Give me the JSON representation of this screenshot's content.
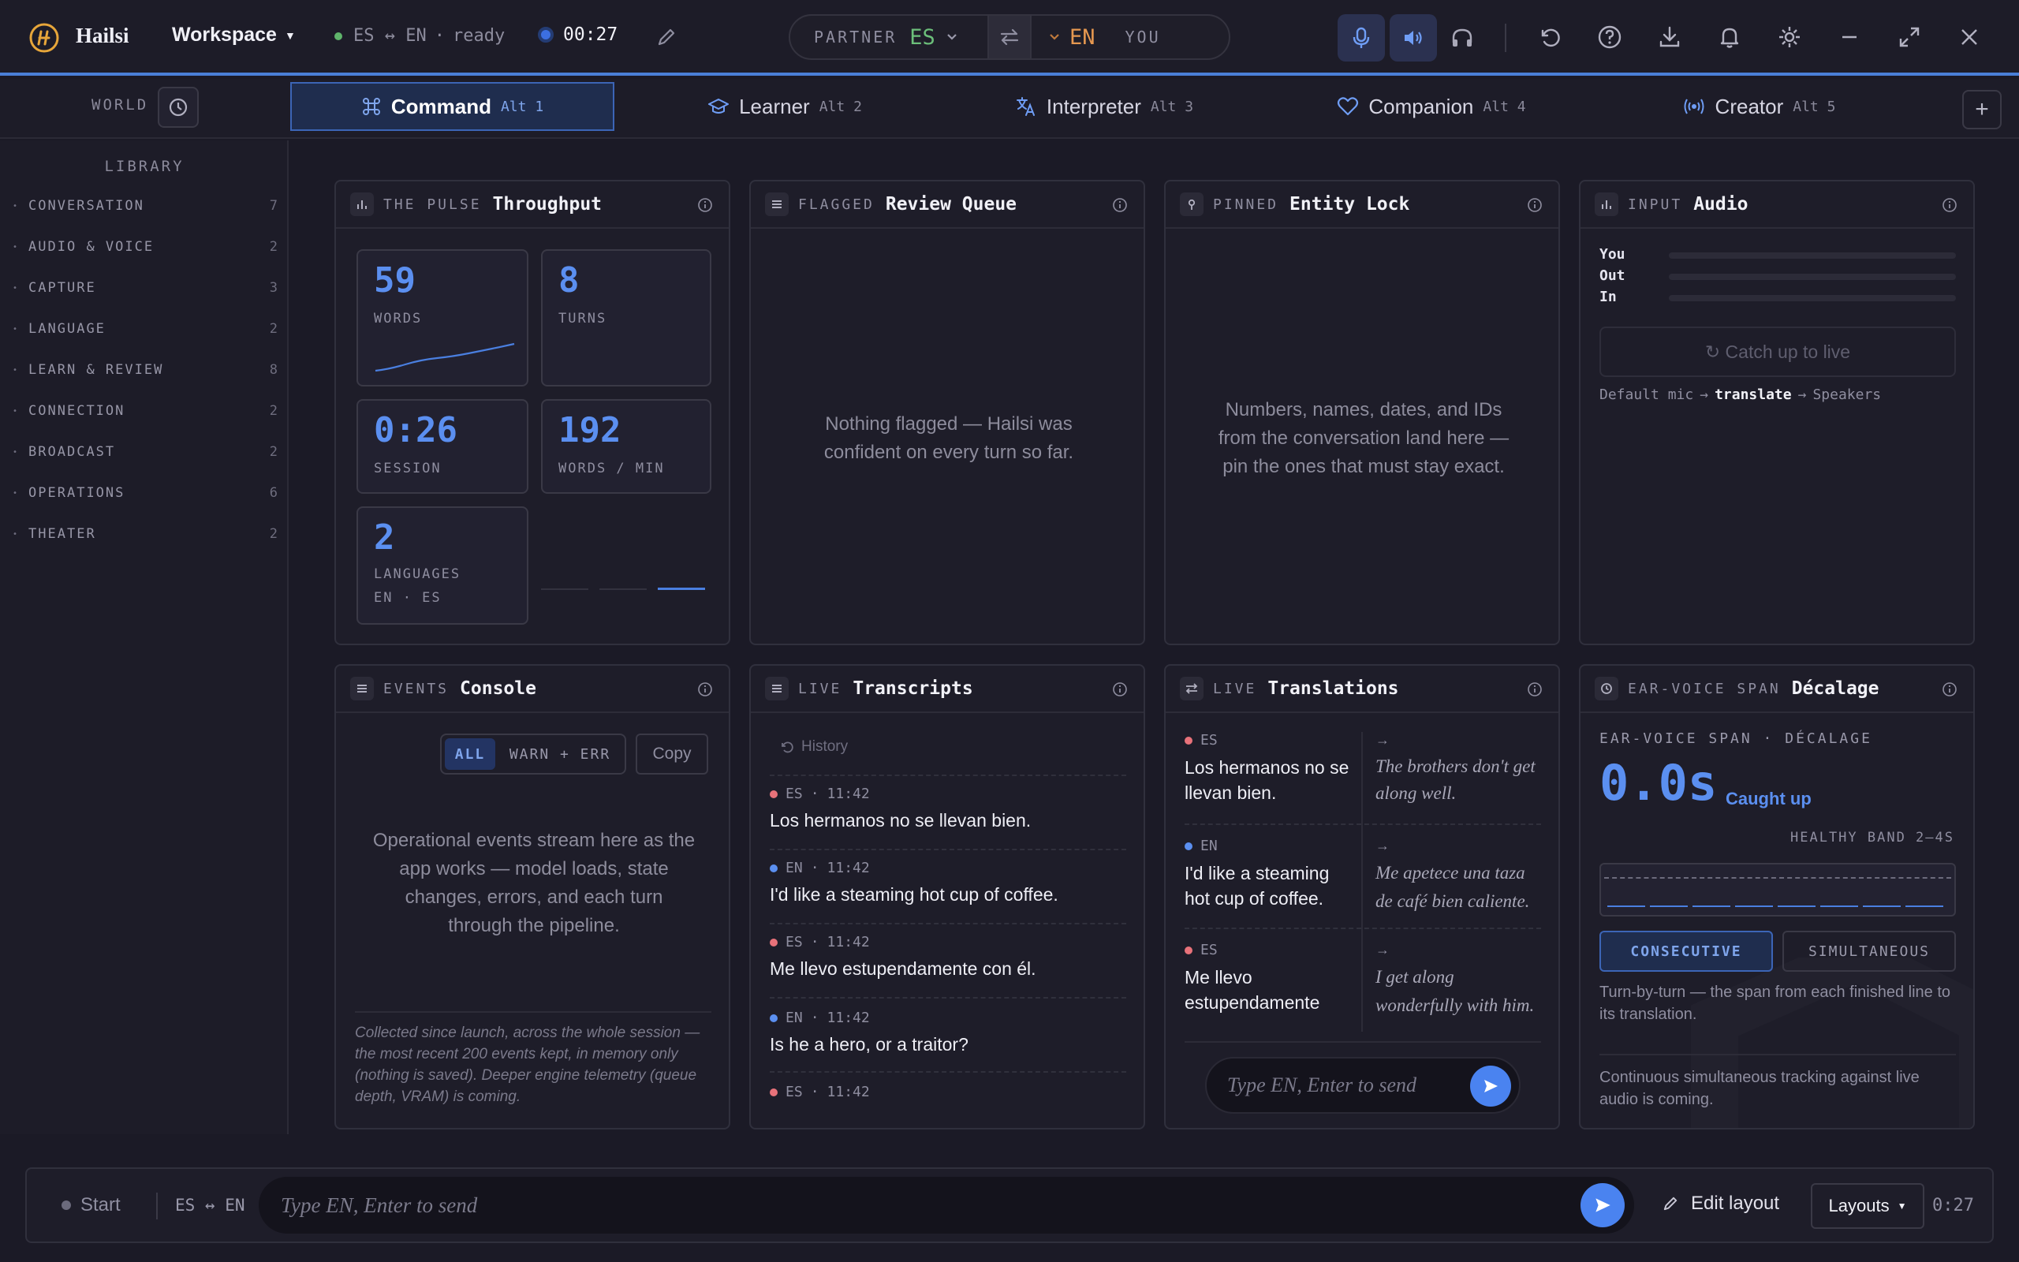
{
  "app": {
    "name": "Hailsi",
    "workspace": "Workspace"
  },
  "status": {
    "pair": "ES ↔ EN",
    "state": "ready",
    "timer": "00:27"
  },
  "pair_pill": {
    "partner_label": "PARTNER",
    "partner_lang": "ES",
    "you_lang": "EN",
    "you_label": "YOU"
  },
  "colors": {
    "accent": "#5b8ff0",
    "es_green": "#6cbf7a",
    "en_orange": "#e69850",
    "es_dot": "#e8727a",
    "en_dot": "#5b8ff0"
  },
  "tabs": {
    "world": "WORLD",
    "items": [
      {
        "label": "Command",
        "key": "Alt 1"
      },
      {
        "label": "Learner",
        "key": "Alt 2"
      },
      {
        "label": "Interpreter",
        "key": "Alt 3"
      },
      {
        "label": "Companion",
        "key": "Alt 4"
      },
      {
        "label": "Creator",
        "key": "Alt 5"
      }
    ],
    "add": "+"
  },
  "library": {
    "title": "LIBRARY",
    "items": [
      {
        "label": "CONVERSATION",
        "count": "7"
      },
      {
        "label": "AUDIO & VOICE",
        "count": "2"
      },
      {
        "label": "CAPTURE",
        "count": "3"
      },
      {
        "label": "LANGUAGE",
        "count": "2"
      },
      {
        "label": "LEARN & REVIEW",
        "count": "8"
      },
      {
        "label": "CONNECTION",
        "count": "2"
      },
      {
        "label": "BROADCAST",
        "count": "2"
      },
      {
        "label": "OPERATIONS",
        "count": "6"
      },
      {
        "label": "THEATER",
        "count": "2"
      }
    ]
  },
  "pulse": {
    "kicker": "THE PULSE",
    "title": "Throughput",
    "words": "59",
    "words_label": "WORDS",
    "turns": "8",
    "turns_label": "TURNS",
    "session": "0:26",
    "session_label": "SESSION",
    "wpm": "192",
    "wpm_label": "WORDS / MIN",
    "languages": "2",
    "languages_label": "LANGUAGES",
    "languages_list": "EN · ES"
  },
  "review": {
    "kicker": "FLAGGED",
    "title": "Review Queue",
    "empty": "Nothing flagged — Hailsi was confident on every turn so far."
  },
  "entity": {
    "kicker": "PINNED",
    "title": "Entity Lock",
    "empty": "Numbers, names, dates, and IDs from the conversation land here — pin the ones that must stay exact."
  },
  "audio": {
    "kicker": "INPUT",
    "title": "Audio",
    "meters": [
      {
        "label": "You",
        "level": 0
      },
      {
        "label": "Out",
        "level": 0
      },
      {
        "label": "In",
        "level": 0
      }
    ],
    "catchup": "↻ Catch up to live",
    "route_mic": "Default mic",
    "route_mode": "translate",
    "route_out": "Speakers"
  },
  "console": {
    "kicker": "EVENTS",
    "title": "Console",
    "filter_all": "ALL",
    "filter_warn": "WARN + ERR",
    "copy": "Copy",
    "empty": "Operational events stream here as the app works — model loads, state changes, errors, and each turn through the pipeline.",
    "footnote": "Collected since launch, across the whole session — the most recent 200 events kept, in memory only (nothing is saved). Deeper engine telemetry (queue depth, VRAM) is coming."
  },
  "transcripts": {
    "kicker": "LIVE",
    "title": "Transcripts",
    "history": "History",
    "items": [
      {
        "lang": "ES",
        "time": "11:42",
        "text": "Los hermanos no se llevan bien."
      },
      {
        "lang": "EN",
        "time": "11:42",
        "text": "I'd like a steaming hot cup of coffee."
      },
      {
        "lang": "ES",
        "time": "11:42",
        "text": "Me llevo estupendamente con él."
      },
      {
        "lang": "EN",
        "time": "11:42",
        "text": "Is he a hero, or a traitor?"
      },
      {
        "lang": "ES",
        "time": "11:42",
        "text": ""
      }
    ]
  },
  "translations": {
    "kicker": "LIVE",
    "title": "Translations",
    "arrow": "→",
    "items": [
      {
        "lang": "ES",
        "src1": "Los hermanos no se",
        "src2": "llevan bien.",
        "tgt1": "The brothers don't get",
        "tgt2": "along well."
      },
      {
        "lang": "EN",
        "src1": "I'd like a steaming",
        "src2": "hot cup of coffee.",
        "tgt1": "Me apetece una taza",
        "tgt2": "de café bien caliente."
      },
      {
        "lang": "ES",
        "src1": "Me llevo",
        "src2": "estupendamente",
        "tgt1": "I get along",
        "tgt2": "wonderfully with him."
      }
    ],
    "input_placeholder": "Type EN, Enter to send"
  },
  "decalage": {
    "kicker": "EAR-VOICE SPAN",
    "title": "Décalage",
    "subtitle": "EAR-VOICE SPAN · DÉCALAGE",
    "value": "0.0s",
    "state": "Caught up",
    "band": "HEALTHY BAND 2–4S",
    "mode_consecutive": "CONSECUTIVE",
    "mode_simultaneous": "SIMULTANEOUS",
    "desc": "Turn-by-turn — the span from each finished line to its translation.",
    "note": "Continuous simultaneous tracking against live audio is coming."
  },
  "bottom": {
    "start": "Start",
    "pair": "ES ↔ EN",
    "input_placeholder": "Type EN, Enter to send",
    "edit_layout": "Edit layout",
    "layouts": "Layouts",
    "timer": "0:27"
  }
}
